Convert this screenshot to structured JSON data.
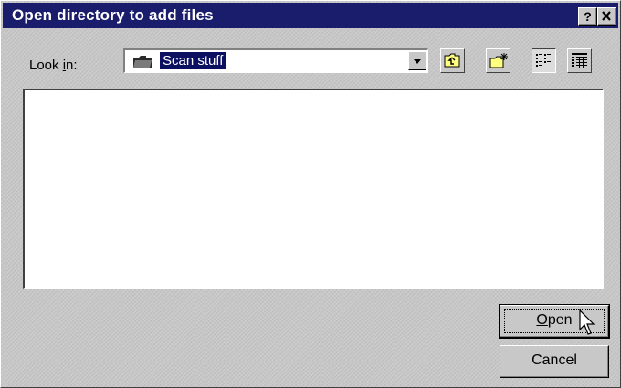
{
  "window": {
    "title": "Open directory to add files",
    "help_button": "?",
    "close_button": "✕"
  },
  "toolbar": {
    "look_in_label_pre": "Look ",
    "look_in_label_accel": "i",
    "look_in_label_post": "n:",
    "current_folder": "Scan stuff",
    "tools": [
      "up-one-level-icon",
      "create-new-folder-icon",
      "list-view-icon",
      "details-view-icon"
    ]
  },
  "file_list": {
    "items": []
  },
  "buttons": {
    "open_accel": "O",
    "open_rest": "pen",
    "cancel": "Cancel"
  }
}
